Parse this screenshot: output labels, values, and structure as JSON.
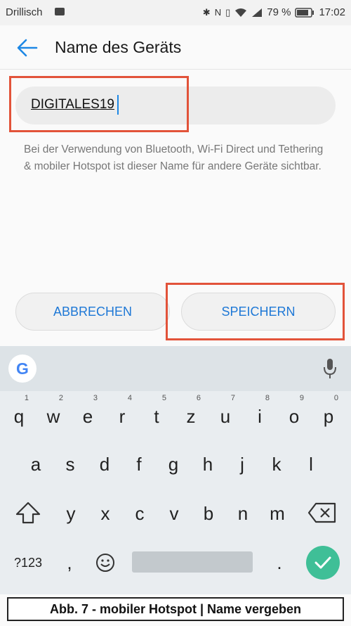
{
  "status_bar": {
    "carrier": "Drillisch",
    "battery_percent": "79 %",
    "time": "17:02"
  },
  "app_bar": {
    "title": "Name des Geräts"
  },
  "device_name_field": {
    "value": "DIGITALES19"
  },
  "help_text": "Bei der Verwendung von Bluetooth, Wi-Fi Direct und Tethering & mobiler Hotspot ist dieser Name für andere Geräte sichtbar.",
  "buttons": {
    "cancel": "ABBRECHEN",
    "save": "SPEICHERN"
  },
  "keyboard": {
    "row1": [
      {
        "key": "q",
        "hint": "1"
      },
      {
        "key": "w",
        "hint": "2"
      },
      {
        "key": "e",
        "hint": "3"
      },
      {
        "key": "r",
        "hint": "4"
      },
      {
        "key": "t",
        "hint": "5"
      },
      {
        "key": "z",
        "hint": "6"
      },
      {
        "key": "u",
        "hint": "7"
      },
      {
        "key": "i",
        "hint": "8"
      },
      {
        "key": "o",
        "hint": "9"
      },
      {
        "key": "p",
        "hint": "0"
      }
    ],
    "row2": [
      "a",
      "s",
      "d",
      "f",
      "g",
      "h",
      "j",
      "k",
      "l"
    ],
    "row3": [
      "y",
      "x",
      "c",
      "v",
      "b",
      "n",
      "m"
    ],
    "symbols_key": "?123",
    "comma_key": ",",
    "period_key": "."
  },
  "caption": "Abb. 7 - mobiler Hotspot | Name vergeben",
  "colors": {
    "accent": "#1e78d6",
    "highlight_box": "#e2533a",
    "enter_key": "#3fbf97"
  }
}
